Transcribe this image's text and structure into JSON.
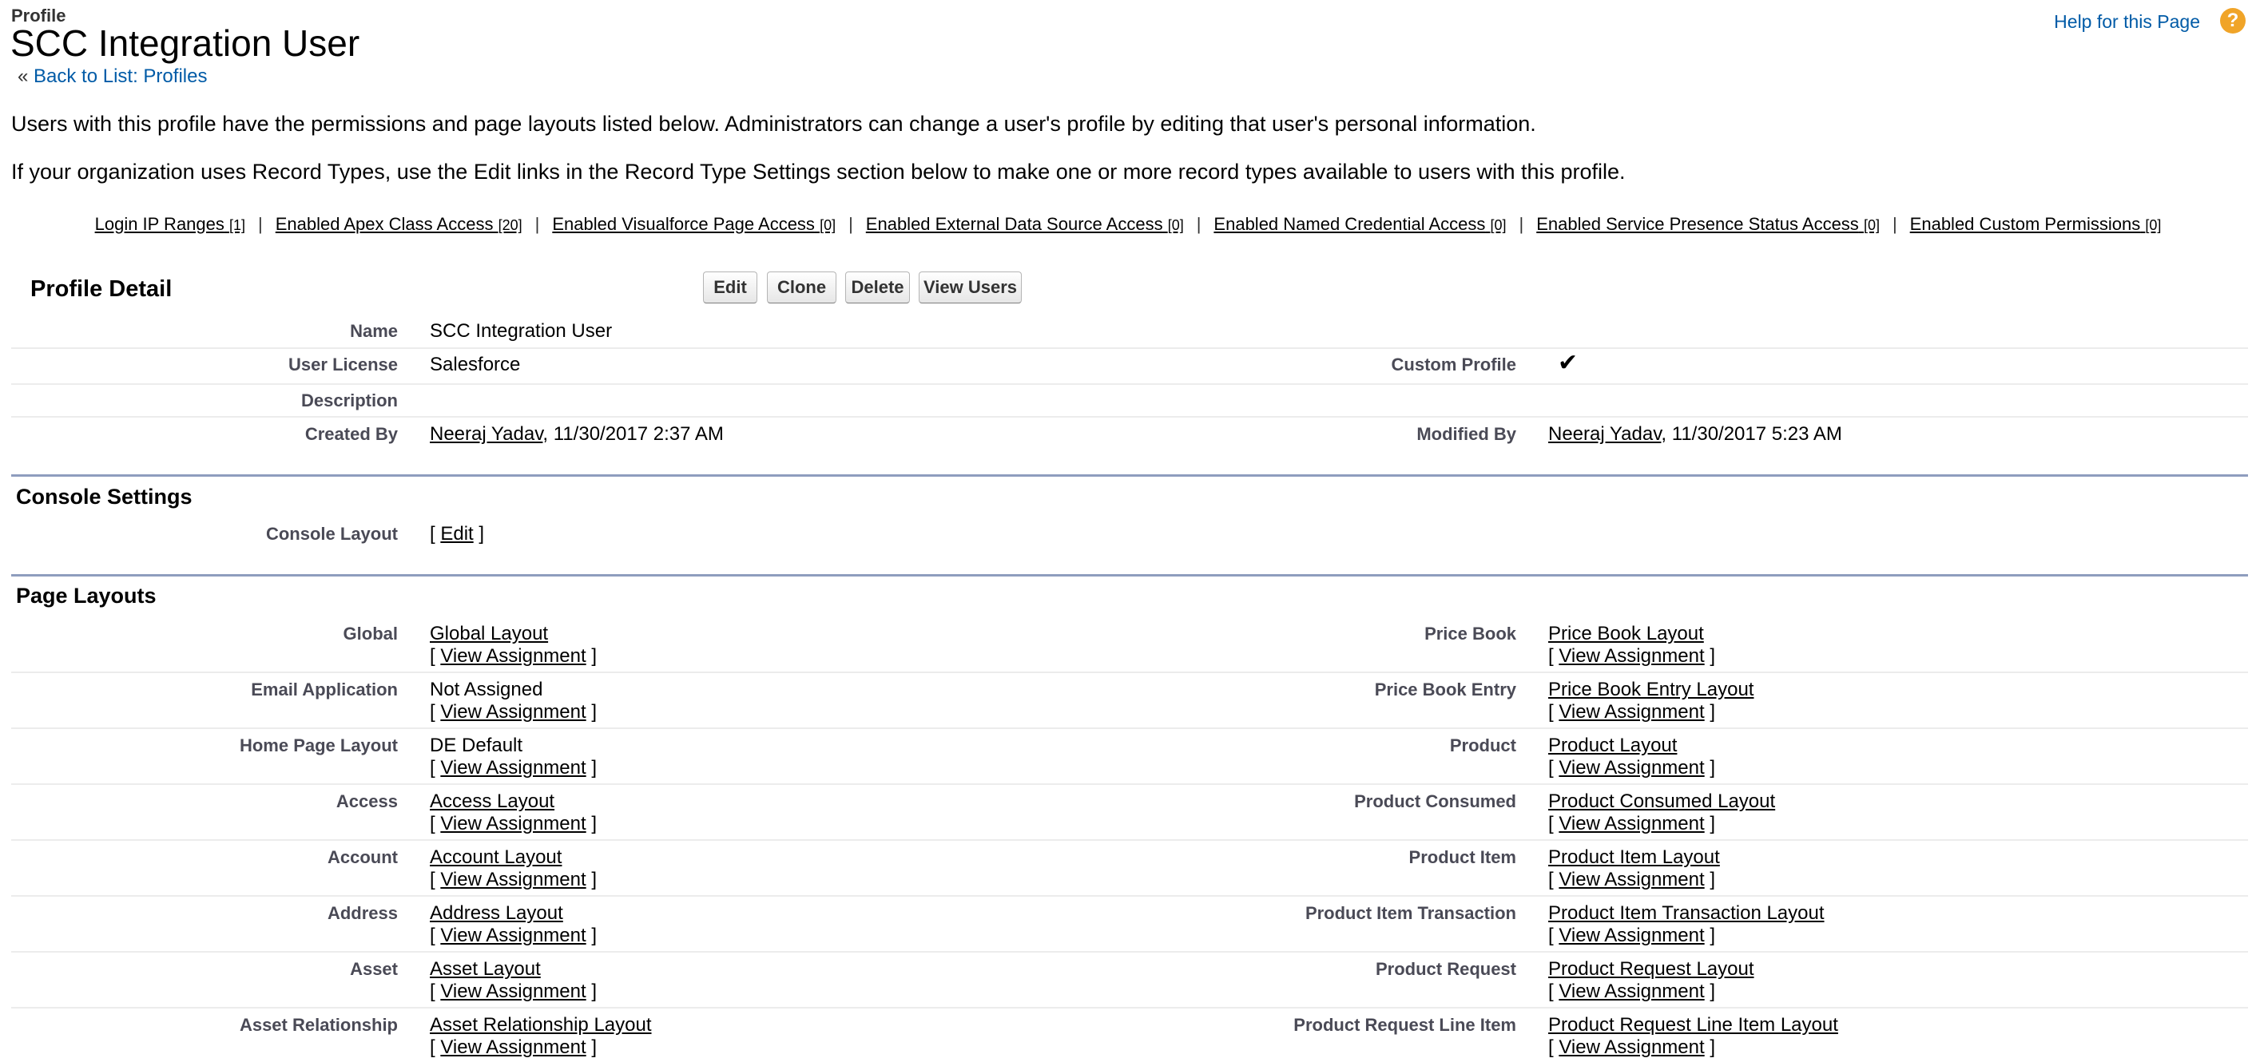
{
  "header": {
    "breadcrumb": "Profile",
    "title": "SCC Integration User",
    "back_prefix": "«",
    "back_link": "Back to List: Profiles",
    "help_link": "Help for this Page",
    "help_icon": "?"
  },
  "intro": {
    "line1": "Users with this profile have the permissions and page layouts listed below. Administrators can change a user's profile by editing that user's personal information.",
    "line2": "If your organization uses Record Types, use the Edit links in the Record Type Settings section below to make one or more record types available to users with this profile."
  },
  "related_links": [
    {
      "label": "Login IP Ranges",
      "count": "[1]"
    },
    {
      "label": "Enabled Apex Class Access",
      "count": "[20]"
    },
    {
      "label": "Enabled Visualforce Page Access",
      "count": "[0]"
    },
    {
      "label": "Enabled External Data Source Access",
      "count": "[0]"
    },
    {
      "label": "Enabled Named Credential Access",
      "count": "[0]"
    },
    {
      "label": "Enabled Service Presence Status Access",
      "count": "[0]"
    },
    {
      "label": "Enabled Custom Permissions",
      "count": "[0]"
    }
  ],
  "separator": "|",
  "profile_detail": {
    "title": "Profile Detail",
    "buttons": {
      "edit": "Edit",
      "clone": "Clone",
      "delete": "Delete",
      "view_users": "View Users"
    },
    "name_label": "Name",
    "name_value": "SCC Integration User",
    "license_label": "User License",
    "license_value": "Salesforce",
    "custom_label": "Custom Profile",
    "custom_check": "✔",
    "description_label": "Description",
    "created_label": "Created By",
    "created_user": "Neeraj Yadav",
    "created_date": ", 11/30/2017 2:37 AM",
    "modified_label": "Modified By",
    "modified_user": "Neeraj Yadav",
    "modified_date": ", 11/30/2017 5:23 AM"
  },
  "console_settings": {
    "title": "Console Settings",
    "layout_label": "Console Layout",
    "bracket_open": "[",
    "edit_link": "Edit",
    "bracket_close": "]"
  },
  "page_layouts": {
    "title": "Page Layouts",
    "view_assignment": "View Assignment",
    "bracket_open": "[",
    "bracket_close": "]",
    "rows": [
      {
        "left": {
          "label": "Global",
          "value": "Global Layout",
          "link": true
        },
        "right": {
          "label": "Price Book",
          "value": "Price Book Layout",
          "link": true
        }
      },
      {
        "left": {
          "label": "Email Application",
          "value": "Not Assigned",
          "link": false
        },
        "right": {
          "label": "Price Book Entry",
          "value": "Price Book Entry Layout",
          "link": true
        }
      },
      {
        "left": {
          "label": "Home Page Layout",
          "value": "DE Default",
          "link": false
        },
        "right": {
          "label": "Product",
          "value": "Product Layout",
          "link": true
        }
      },
      {
        "left": {
          "label": "Access",
          "value": "Access Layout",
          "link": true
        },
        "right": {
          "label": "Product Consumed",
          "value": "Product Consumed Layout",
          "link": true
        }
      },
      {
        "left": {
          "label": "Account",
          "value": "Account Layout",
          "link": true
        },
        "right": {
          "label": "Product Item",
          "value": "Product Item Layout",
          "link": true
        }
      },
      {
        "left": {
          "label": "Address",
          "value": "Address Layout",
          "link": true
        },
        "right": {
          "label": "Product Item Transaction",
          "value": "Product Item Transaction Layout",
          "link": true
        }
      },
      {
        "left": {
          "label": "Asset",
          "value": "Asset Layout",
          "link": true
        },
        "right": {
          "label": "Product Request",
          "value": "Product Request Layout",
          "link": true
        }
      },
      {
        "left": {
          "label": "Asset Relationship",
          "value": "Asset Relationship Layout",
          "link": true
        },
        "right": {
          "label": "Product Request Line Item",
          "value": "Product Request Line Item Layout",
          "link": true
        }
      }
    ]
  }
}
